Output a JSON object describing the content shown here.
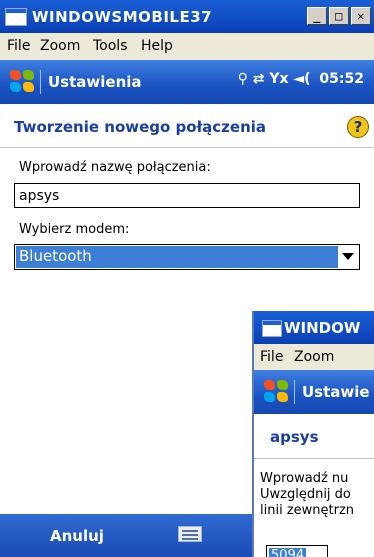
{
  "window": {
    "title": "WINDOWSMOBILE37",
    "controls": {
      "minimize": "_",
      "maximize": "□",
      "close": "✕"
    }
  },
  "menu": [
    "File",
    "Zoom",
    "Tools",
    "Help"
  ],
  "navbar": {
    "title": "Ustawienia",
    "status_icons": "⚲ ⇄ Yx ◄(",
    "time": "05:52"
  },
  "page": {
    "title": "Tworzenie nowego połączenia",
    "help": "?"
  },
  "form": {
    "name_label": "Wprowadź nazwę połączenia:",
    "name_value": "apsys",
    "modem_label": "Wybierz modem:",
    "modem_value": "Bluetooth"
  },
  "softkeys": {
    "left": "Anuluj"
  },
  "second_window": {
    "title": "WINDOW",
    "menu": [
      "File",
      "Zoom"
    ],
    "nav_title": "Ustawie",
    "page_title": "apsys",
    "text_lines": [
      "Wprowadź nu",
      "Uwzględnij do",
      "linii zewnętrzn"
    ],
    "field_value": "5094"
  },
  "colors": {
    "titlebar": "#0a3fb4",
    "navbar": "#1a52c2",
    "selection": "#3d7fd6",
    "page_title": "#1a3f9e"
  }
}
